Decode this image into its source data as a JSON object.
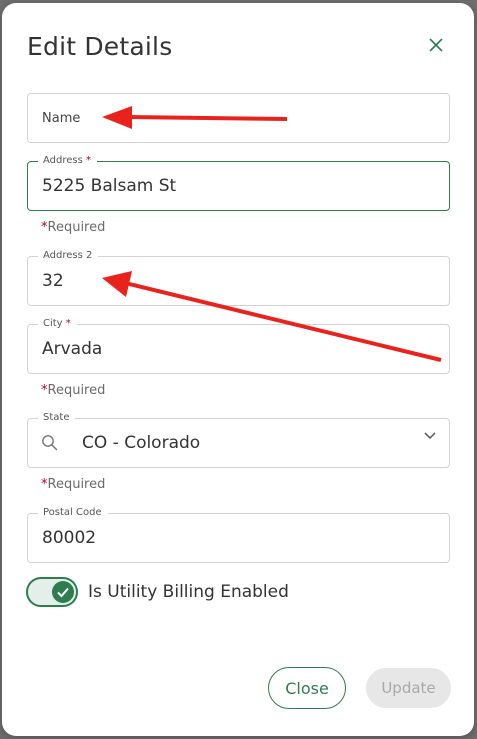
{
  "dialog": {
    "title": "Edit Details",
    "close_icon": "close-icon"
  },
  "fields": {
    "name": {
      "placeholder": "Name",
      "value": ""
    },
    "address": {
      "label": "Address",
      "value": "5225 Balsam St",
      "required_text": "Required"
    },
    "address2": {
      "label": "Address 2",
      "value": "32"
    },
    "city": {
      "label": "City",
      "value": "Arvada",
      "required_text": "Required"
    },
    "state": {
      "label": "State",
      "value": "CO - Colorado",
      "required_text": "Required",
      "search_icon": "search-icon",
      "dropdown_icon": "chevron-down-icon"
    },
    "postal_code": {
      "label": "Postal Code",
      "value": "80002"
    }
  },
  "required_marker": "*",
  "toggle": {
    "label": "Is Utility Billing Enabled",
    "enabled": true,
    "icon": "check-icon"
  },
  "buttons": {
    "close_label": "Close",
    "update_label": "Update"
  },
  "annotations": {
    "arrow_color": "#e8231d"
  },
  "colors": {
    "accent": "#2e7d4f",
    "required_star": "#b00020",
    "disabled_bg": "#e7e7e7"
  }
}
